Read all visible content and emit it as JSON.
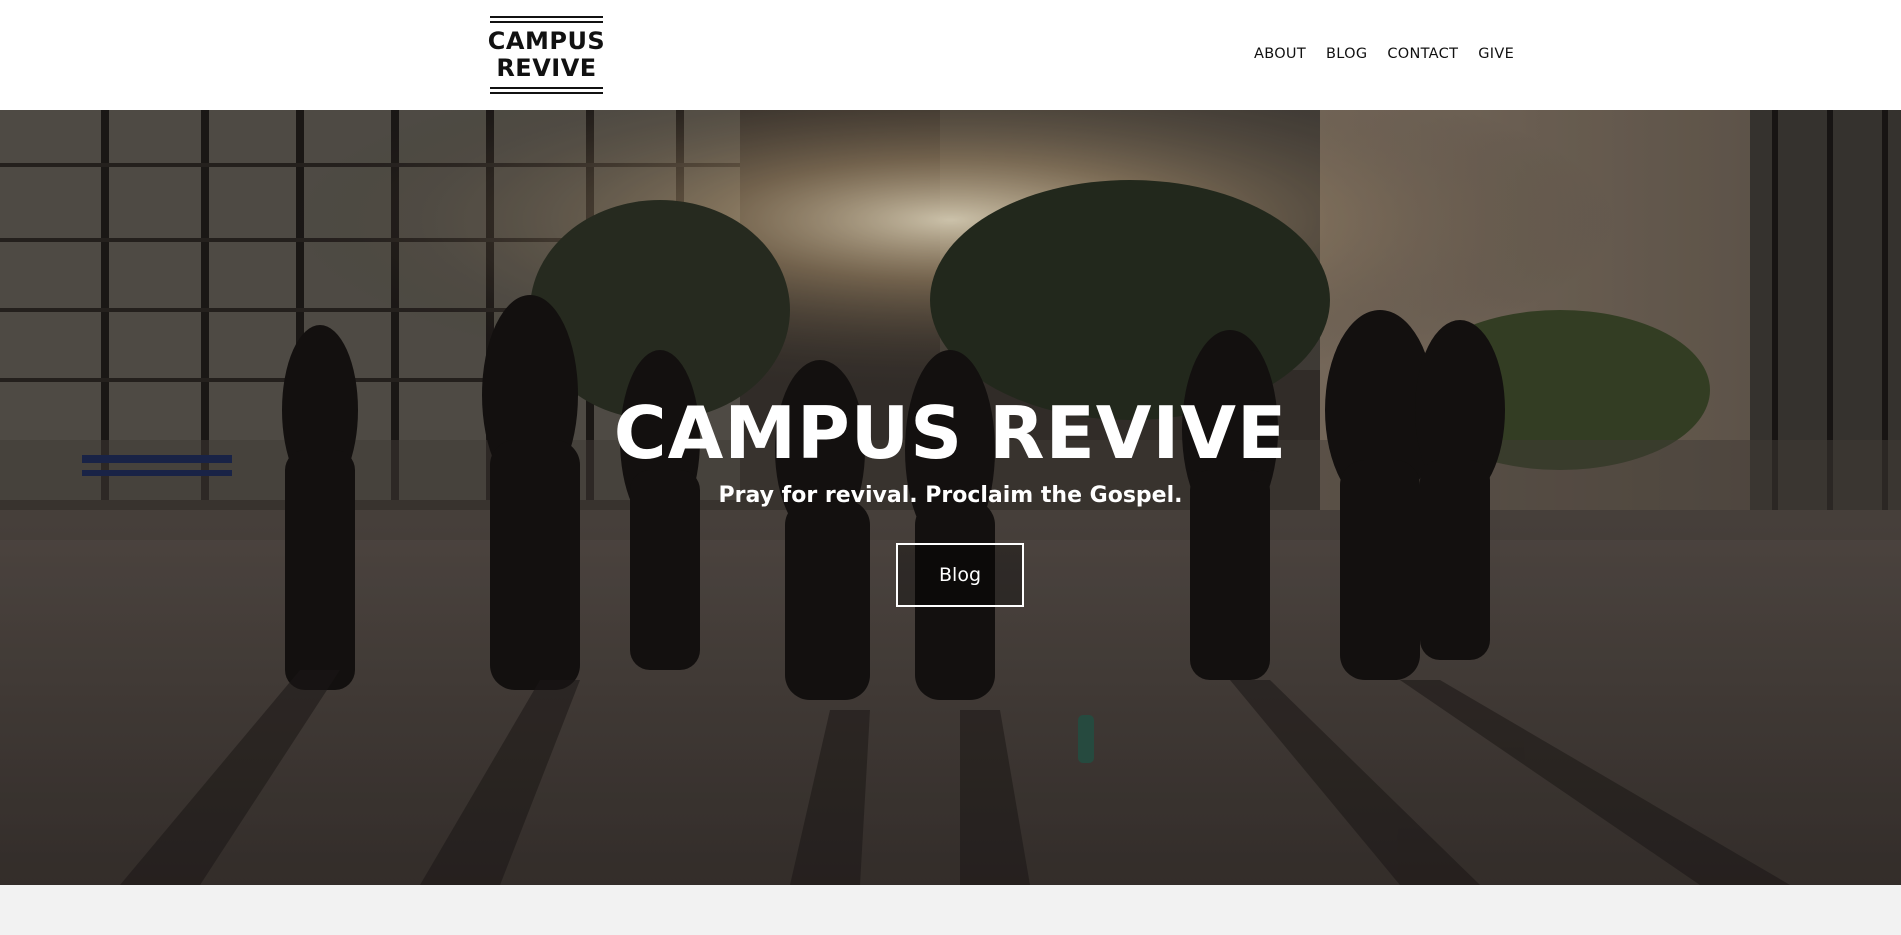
{
  "header": {
    "logo": {
      "line1": "CAMPUS",
      "line2": "REVIVE"
    },
    "nav": [
      {
        "label": "ABOUT"
      },
      {
        "label": "BLOG"
      },
      {
        "label": "CONTACT"
      },
      {
        "label": "GIVE"
      }
    ]
  },
  "hero": {
    "title": "CAMPUS REVIVE",
    "subtitle": "Pray for revival. Proclaim the Gospel.",
    "button_label": "Blog",
    "background_image": "photo of students standing in a prayer circle on a campus plaza at night"
  },
  "colors": {
    "header_bg": "#ffffff",
    "text_dark": "#111111",
    "hero_text": "#ffffff",
    "below_bg": "#f2f2f2"
  }
}
